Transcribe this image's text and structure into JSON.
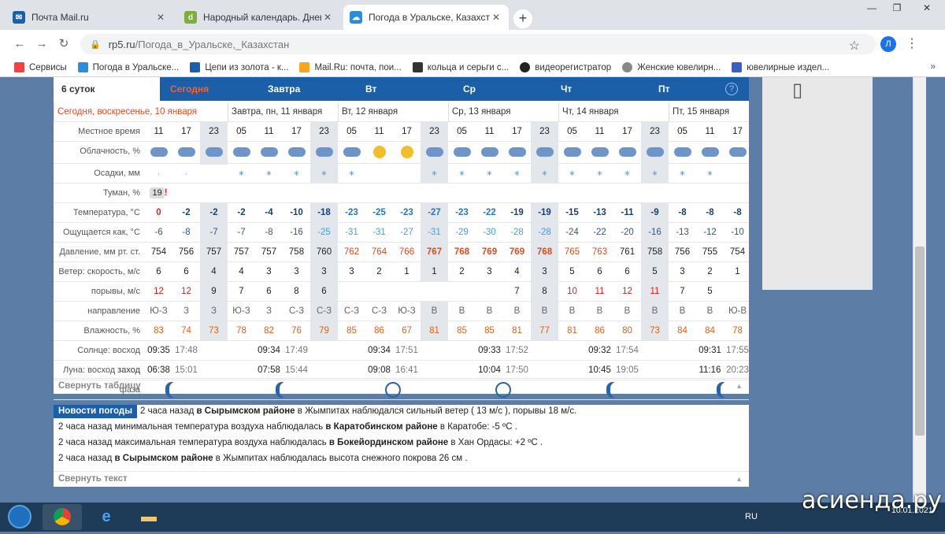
{
  "browser": {
    "tabs": [
      {
        "title": "Почта Mail.ru",
        "color": "#1a5fa8"
      },
      {
        "title": "Народный календарь. Дневник",
        "color": "#7cae3a"
      },
      {
        "title": "Погода в Уральске, Казахстан -",
        "color": "#2a8fd6"
      }
    ],
    "url_domain": "rp5.ru",
    "url_path": "/Погода_в_Уральске,_Казахстан",
    "profile_initial": "Л",
    "bookmarks": [
      {
        "label": "Сервисы",
        "color": "#e44"
      },
      {
        "label": "Погода в Уральске...",
        "color": "#2a8fd6"
      },
      {
        "label": "Цепи из золота - к...",
        "color": "#1a5fa8"
      },
      {
        "label": "Mail.Ru: почта, пои...",
        "color": "#f5a623"
      },
      {
        "label": "кольца и серьги с...",
        "color": "#333"
      },
      {
        "label": "видеорегистратор",
        "color": "#222"
      },
      {
        "label": "Женские ювелирн...",
        "color": "#888"
      },
      {
        "label": "ювелирные издел...",
        "color": "#3b5fc2"
      }
    ]
  },
  "forecast": {
    "day_tabs": [
      "6 суток",
      "Сегодня",
      "Завтра",
      "Вт",
      "Ср",
      "Чт",
      "Пт"
    ],
    "help": "?",
    "day_headers": [
      "Сегодня, воскресенье, 10 января",
      "Завтра, пн, 11 января",
      "Вт, 12 января",
      "Ср, 13 января",
      "Чт, 14 января",
      "Пт, 15 января"
    ],
    "labels": {
      "time": "Местное время",
      "clouds": "Облачность, %",
      "precip": "Осадки, мм",
      "fog": "Туман, %",
      "temp": "Температура, °C",
      "feels": "Ощущается как, °C",
      "pressure": "Давление, мм рт. ст.",
      "wind_speed": "Ветер: скорость, м/с",
      "gusts": "порывы, м/с",
      "direction": "направление",
      "humidity": "Влажность, %",
      "sun": "Солнце: восход заход",
      "moon": "Луна: восход заход",
      "phase": "фаза"
    },
    "times": [
      "11",
      "17",
      "23",
      "05",
      "11",
      "17",
      "23",
      "05",
      "11",
      "17",
      "23",
      "05",
      "11",
      "17",
      "23",
      "05",
      "11",
      "17",
      "23",
      "05",
      "11",
      "17"
    ],
    "fog_value": "19",
    "fog_alert": "!",
    "temperature": [
      "0",
      "-2",
      "-2",
      "-2",
      "-4",
      "-10",
      "-18",
      "-23",
      "-25",
      "-23",
      "-27",
      "-23",
      "-22",
      "-19",
      "-19",
      "-15",
      "-13",
      "-11",
      "-9",
      "-8",
      "-8",
      "-8"
    ],
    "feels_like": [
      "-6",
      "-8",
      "-7",
      "-7",
      "-8",
      "-16",
      "-25",
      "-31",
      "-31",
      "-27",
      "-31",
      "-29",
      "-30",
      "-28",
      "-28",
      "-24",
      "-22",
      "-20",
      "-16",
      "-13",
      "-12",
      "-10"
    ],
    "pressure": [
      "754",
      "756",
      "757",
      "757",
      "757",
      "758",
      "760",
      "762",
      "764",
      "766",
      "767",
      "768",
      "769",
      "769",
      "768",
      "765",
      "763",
      "761",
      "758",
      "756",
      "755",
      "754"
    ],
    "wind_speed": [
      "6",
      "6",
      "4",
      "4",
      "3",
      "3",
      "3",
      "3",
      "2",
      "1",
      "1",
      "2",
      "3",
      "4",
      "3",
      "5",
      "6",
      "6",
      "5",
      "3",
      "2",
      "1"
    ],
    "gusts": [
      "12",
      "12",
      "9",
      "7",
      "6",
      "8",
      "6",
      "",
      "",
      "",
      "",
      "",
      "",
      "7",
      "8",
      "10",
      "11",
      "12",
      "11",
      "7",
      "5",
      ""
    ],
    "direction": [
      "Ю-З",
      "З",
      "З",
      "Ю-З",
      "З",
      "С-З",
      "С-З",
      "С-З",
      "С-З",
      "Ю-З",
      "В",
      "В",
      "В",
      "В",
      "В",
      "В",
      "В",
      "В",
      "В",
      "В",
      "В",
      "Ю-В"
    ],
    "humidity": [
      "83",
      "74",
      "73",
      "78",
      "82",
      "76",
      "79",
      "85",
      "86",
      "67",
      "81",
      "85",
      "85",
      "81",
      "77",
      "81",
      "86",
      "80",
      "73",
      "84",
      "84",
      "78"
    ],
    "sun": [
      {
        "rise": "09:35",
        "set": "17:48"
      },
      {
        "rise": "09:34",
        "set": "17:49"
      },
      {
        "rise": "09:34",
        "set": "17:51"
      },
      {
        "rise": "09:33",
        "set": "17:52"
      },
      {
        "rise": "09:32",
        "set": "17:54"
      },
      {
        "rise": "09:31",
        "set": "17:55"
      }
    ],
    "moon": [
      {
        "rise": "06:38",
        "set": "15:01"
      },
      {
        "rise": "07:58",
        "set": "15:44"
      },
      {
        "rise": "09:08",
        "set": "16:41"
      },
      {
        "rise": "10:04",
        "set": "17:50"
      },
      {
        "rise": "10:45",
        "set": "19:05"
      },
      {
        "rise": "11:16",
        "set": "20:23"
      }
    ],
    "collapse_label": "Свернуть таблицу"
  },
  "news": {
    "header": "Новости погоды",
    "items": [
      {
        "pre": "2 часа назад",
        "bold": "в Сырымском районе",
        "post": "в Жымпитах наблюдался сильный ветер ( 13 м/с ), порывы 18 м/с."
      },
      {
        "pre": "2 часа назад минимальная температура воздуха наблюдалась",
        "bold": "в Каратобинском районе",
        "post": "в Каратобе: -5 ºС ."
      },
      {
        "pre": "2 часа назад максимальная температура воздуха наблюдалась",
        "bold": "в Бокейординском районе",
        "post": "в Хан Ордасы: +2 ºС ."
      },
      {
        "pre": "2 часа назад",
        "bold": "в Сырымском районе",
        "post": "в Жымпитах наблюдалась высота снежного покрова 26 см ."
      }
    ],
    "collapse_label": "Свернуть текст"
  },
  "taskbar": {
    "lang": "RU",
    "time": "",
    "date": "10.01.2021"
  },
  "watermark": "асиенда.ру"
}
